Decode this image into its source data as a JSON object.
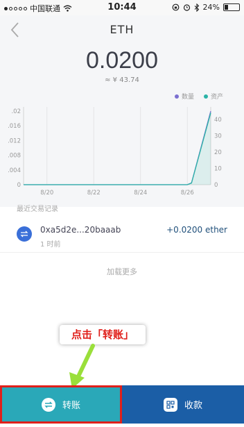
{
  "status_bar": {
    "carrier": "中国联通",
    "time": "10:44",
    "battery": "24%",
    "battery_level": 0.24
  },
  "header": {
    "title": "ETH",
    "balance": "0.0200",
    "fiat_value": "≈ ¥ 43.74"
  },
  "legend": {
    "quantity_label": "数量",
    "quantity_color": "#7b6fd0",
    "asset_label": "资产",
    "asset_color": "#2ab3a6"
  },
  "chart_data": {
    "type": "line",
    "x_ticks": [
      "8/20",
      "8/22",
      "8/24",
      "8/26"
    ],
    "y_left_ticks": [
      ".02",
      ".016",
      ".012",
      ".008",
      ".004",
      "0"
    ],
    "y_right_ticks": [
      "40",
      "30",
      "20",
      "10",
      "0"
    ],
    "ylim_left": [
      0,
      0.02
    ],
    "ylim_right": [
      0,
      45
    ],
    "series": [
      {
        "name": "数量",
        "color": "#7b6fd0",
        "axis": "left",
        "points": [
          [
            "8/19",
            0
          ],
          [
            "8/20",
            0
          ],
          [
            "8/21",
            0
          ],
          [
            "8/22",
            0
          ],
          [
            "8/23",
            0
          ],
          [
            "8/24",
            0
          ],
          [
            "8/25",
            0
          ],
          [
            "8/26",
            0
          ],
          [
            "8/26",
            0.0005
          ],
          [
            "8/27",
            0.02
          ]
        ]
      },
      {
        "name": "资产",
        "color": "#2ab3a6",
        "axis": "right",
        "points": [
          [
            "8/19",
            0
          ],
          [
            "8/20",
            0
          ],
          [
            "8/21",
            0
          ],
          [
            "8/22",
            0
          ],
          [
            "8/23",
            0
          ],
          [
            "8/24",
            0
          ],
          [
            "8/25",
            0
          ],
          [
            "8/26",
            0
          ],
          [
            "8/26",
            1
          ],
          [
            "8/27",
            44
          ]
        ]
      }
    ],
    "grid": "vertical"
  },
  "transactions": {
    "section_label": "最近交易记录",
    "items": [
      {
        "address": "0xa5d2e...20baaab",
        "time": "1 时前",
        "amount": "+0.0200 ether"
      }
    ],
    "load_more": "加载更多"
  },
  "annotation": {
    "text": "点击「转账」"
  },
  "actions": {
    "transfer_label": "转账",
    "receive_label": "收款",
    "transfer_color": "#2aa8b8",
    "receive_color": "#1b5ea6"
  }
}
